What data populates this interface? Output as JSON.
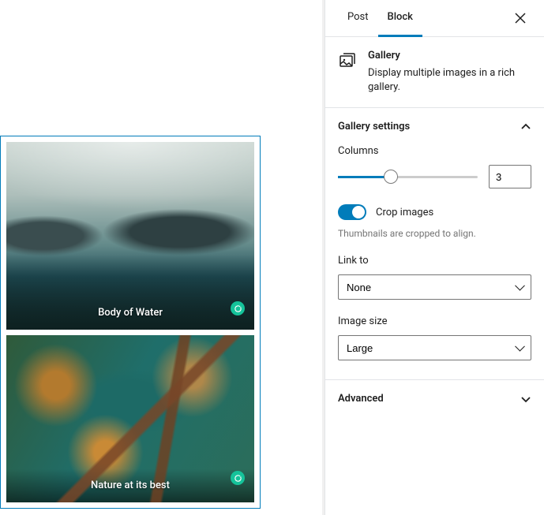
{
  "tabs": {
    "post": "Post",
    "block": "Block",
    "active": "block"
  },
  "block_header": {
    "title": "Gallery",
    "description": "Display multiple images in a rich gallery."
  },
  "panels": {
    "gallery_settings": {
      "title": "Gallery settings",
      "expanded": true
    },
    "advanced": {
      "title": "Advanced",
      "expanded": false
    }
  },
  "settings": {
    "columns": {
      "label": "Columns",
      "value": "3"
    },
    "crop": {
      "label": "Crop images",
      "help": "Thumbnails are cropped to align.",
      "enabled": true
    },
    "link_to": {
      "label": "Link to",
      "value": "None"
    },
    "image_size": {
      "label": "Image size",
      "value": "Large"
    }
  },
  "gallery": {
    "items": [
      {
        "caption": "Body of Water"
      },
      {
        "caption": "Nature at its best"
      }
    ]
  }
}
